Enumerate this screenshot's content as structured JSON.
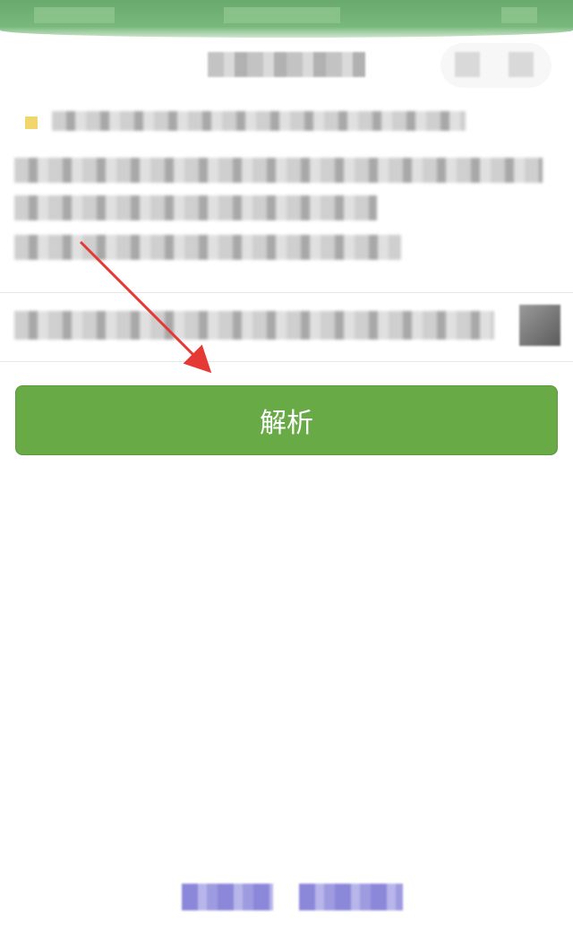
{
  "app": {
    "header_title": "",
    "notice_text": "",
    "info_lines": [
      "",
      "",
      ""
    ],
    "input_value": ""
  },
  "parse_button": {
    "label": "解析"
  },
  "footer": {
    "links": [
      "",
      ""
    ]
  },
  "colors": {
    "primary_button": "#67aa46",
    "top_bar": "#6aa96d",
    "annotation_arrow": "#e53935",
    "footer_link": "#8c88d9"
  },
  "icons": {
    "notice": "folder-icon",
    "header_more": "more-icon",
    "header_close": "close-icon",
    "input_thumb": "thumbnail-icon"
  }
}
